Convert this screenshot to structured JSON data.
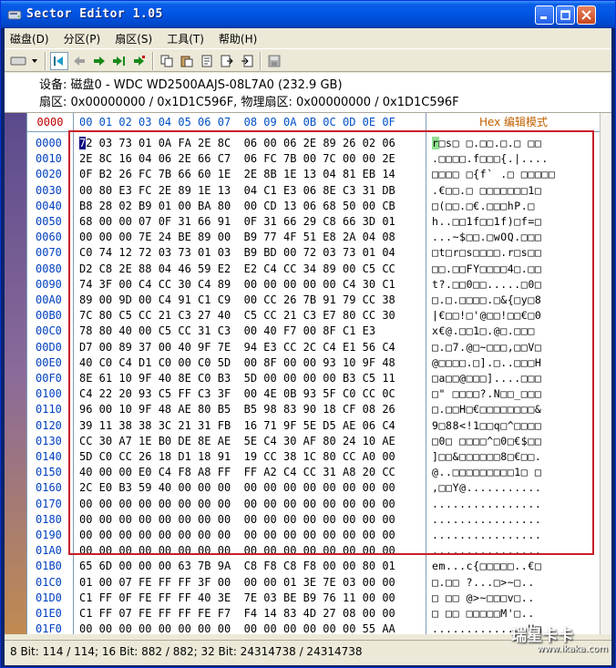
{
  "window": {
    "title": "Sector Editor 1.05",
    "buttons": {
      "minimize": "minimize-icon",
      "maximize": "maximize-icon",
      "close": "close-icon"
    }
  },
  "menu": [
    "磁盘(D)",
    "分区(P)",
    "扇区(S)",
    "工具(T)",
    "帮助(H)"
  ],
  "toolbar": {
    "icons": [
      "drive-dropdown-icon",
      "first-sector-icon",
      "prev-sector-icon",
      "next-sector-icon",
      "last-sector-icon",
      "goto-icon",
      "copy-icon",
      "paste-icon",
      "load-icon",
      "export-icon",
      "import-icon",
      "save-icon"
    ]
  },
  "info": {
    "device_line": "设备: 磁盘0 - WDC WD2500AAJS-08L7A0 (232.9 GB)",
    "sector_line": "扇区: 0x00000000 / 0x1D1C596F, 物理扇区: 0x00000000 / 0x1D1C596F"
  },
  "grid": {
    "offset_header": "0000",
    "hex_header": "00 01 02 03 04 05 06 07  08 09 0A 0B 0C 0D 0E 0F",
    "ascii_header": "Hex 编辑模式",
    "rows": [
      {
        "off": "0000",
        "hex": "72 03 73 01 0A FA 2E 8C  06 00 06 2E 89 26 02 06",
        "ascii": "r□s□ □.□□.□.□ □□"
      },
      {
        "off": "0010",
        "hex": "2E 8C 16 04 06 2E 66 C7  06 FC 7B 00 7C 00 00 2E",
        "ascii": ".□□□□.f□□□{.|...."
      },
      {
        "off": "0020",
        "hex": "0F B2 26 FC 7B 66 60 1E  2E 8B 1E 13 04 81 EB 14",
        "ascii": "□□□□ □{f` .□ □□□□□"
      },
      {
        "off": "0030",
        "hex": "00 80 E3 FC 2E 89 1E 13  04 C1 E3 06 8E C3 31 DB",
        "ascii": ".€□□.□ □□□□□□□1□"
      },
      {
        "off": "0040",
        "hex": "B8 28 02 B9 01 00 BA 80  00 CD 13 06 68 50 00 CB",
        "ascii": "□(□□.□€.□□□hP.□"
      },
      {
        "off": "0050",
        "hex": "68 00 00 07 0F 31 66 91  0F 31 66 29 C8 66 3D 01",
        "ascii": "h..□□1f□□1f)□f=□"
      },
      {
        "off": "0060",
        "hex": "00 00 00 7E 24 BE 89 00  B9 77 4F 51 E8 2A 04 08",
        "ascii": "...~$□□.□wOQ.□□□"
      },
      {
        "off": "0070",
        "hex": "C0 74 12 72 03 73 01 03  B9 BD 00 72 03 73 01 04",
        "ascii": "□t□r□s□□□□.r□s□□"
      },
      {
        "off": "0080",
        "hex": "D2 C8 2E 88 04 46 59 E2  E2 C4 CC 34 89 00 C5 CC",
        "ascii": "□□.□□FY□□□□4□.□□"
      },
      {
        "off": "0090",
        "hex": "74 3F 00 C4 CC 30 C4 89  00 00 00 00 00 C4 30 C1",
        "ascii": "t?.□□0□□.....□0□"
      },
      {
        "off": "00A0",
        "hex": "89 00 9D 00 C4 91 C1 C9  00 CC 26 7B 91 79 CC 38",
        "ascii": "□.□.□□□□.□&{□y□8"
      },
      {
        "off": "00B0",
        "hex": "7C 80 C5 CC 21 C3 27 40  C5 CC 21 C3 E7 80 CC 30",
        "ascii": "|€□□!□'@□□!□□€□0"
      },
      {
        "off": "00C0",
        "hex": "78 80 40 00 C5 CC 31 C3  00 40 F7 00 8F C1 E3 ",
        "ascii": "x€@.□□1□.@□.□□□"
      },
      {
        "off": "00D0",
        "hex": "D7 00 89 37 00 40 9F 7E  94 E3 CC 2C C4 E1 56 C4",
        "ascii": "□.□7.@□~□□□,□□V□"
      },
      {
        "off": "00E0",
        "hex": "40 C0 C4 D1 C0 00 C0 5D  00 8F 00 00 93 10 9F 48",
        "ascii": "@□□□□.□].□..□□□H"
      },
      {
        "off": "00F0",
        "hex": "8E 61 10 9F 40 8E C0 B3  5D 00 00 00 00 B3 C5 11",
        "ascii": "□a□□@□□□]....□□□"
      },
      {
        "off": "0100",
        "hex": "C4 22 20 93 C5 FF C3 3F  00 4E 0B 93 5F C0 CC 0C",
        "ascii": "□\" □□□□?.N□□_□□□"
      },
      {
        "off": "0110",
        "hex": "96 00 10 9F 48 AE 80 B5  B5 98 83 90 18 CF 08 26",
        "ascii": "□.□□H□€□□□□□□□□&"
      },
      {
        "off": "0120",
        "hex": "39 11 38 38 3C 21 31 FB  16 71 9F 5E D5 AE 06 C4",
        "ascii": "9□88<!1□□q□^□□□□"
      },
      {
        "off": "0130",
        "hex": "CC 30 A7 1E B0 DE 8E AE  5E C4 30 AF 80 24 10 AE",
        "ascii": "□0□ □□□□^□0□€$□□"
      },
      {
        "off": "0140",
        "hex": "5D C0 CC 26 18 D1 18 91  19 CC 38 1C 80 CC A0 00",
        "ascii": "]□□&□□□□□□8□€□□."
      },
      {
        "off": "0150",
        "hex": "40 00 00 E0 C4 F8 A8 FF  FF A2 C4 CC 31 A8 20 CC",
        "ascii": "@..□□□□□□□□□1□ □"
      },
      {
        "off": "0160",
        "hex": "2C E0 B3 59 40 00 00 00  00 00 00 00 00 00 00 00",
        "ascii": ",□□Y@..........."
      },
      {
        "off": "0170",
        "hex": "00 00 00 00 00 00 00 00  00 00 00 00 00 00 00 00",
        "ascii": "................"
      },
      {
        "off": "0180",
        "hex": "00 00 00 00 00 00 00 00  00 00 00 00 00 00 00 00",
        "ascii": "................"
      },
      {
        "off": "0190",
        "hex": "00 00 00 00 00 00 00 00  00 00 00 00 00 00 00 00",
        "ascii": "................"
      },
      {
        "off": "01A0",
        "hex": "00 00 00 00 00 00 00 00  00 00 00 00 00 00 00 00",
        "ascii": "................"
      },
      {
        "off": "01B0",
        "hex": "65 6D 00 00 00 63 7B 9A  C8 F8 C8 F8 00 00 80 01",
        "ascii": "em...c{□□□□□..€□"
      },
      {
        "off": "01C0",
        "hex": "01 00 07 FE FF FF 3F 00  00 00 01 3E 7E 03 00 00",
        "ascii": "□.□□ ?...□>~□.."
      },
      {
        "off": "01D0",
        "hex": "C1 FF 0F FE FF FF 40 3E  7E 03 BE B9 76 11 00 00",
        "ascii": "□ □□ @>~□□□v□.."
      },
      {
        "off": "01E0",
        "hex": "C1 FF 07 FE FF FF FE F7  F4 14 83 4D 27 08 00 00",
        "ascii": "□ □□ □□□□□M'□.."
      },
      {
        "off": "01F0",
        "hex": "00 00 00 00 00 00 00 00  00 00 00 00 00 00 55 AA",
        "ascii": "..............U□"
      }
    ]
  },
  "status": "8 Bit: 114 / 114;  16 Bit: 882 / 882;  32 Bit: 24314738 / 24314738",
  "watermark": {
    "top": "瑞星卡卡",
    "bottom": "www.ikaka.com"
  },
  "colors": {
    "title_bar": "#0054e3",
    "selection_outline": "#c81e28",
    "offset_text": "#0040c0",
    "header_hex": "#0050c8",
    "ascii_header": "#c06000"
  }
}
